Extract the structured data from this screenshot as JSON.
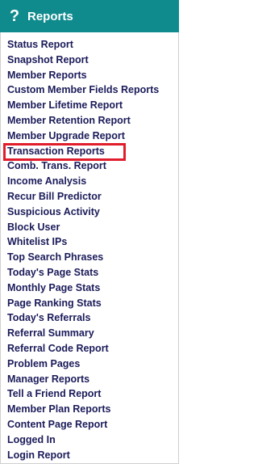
{
  "header": {
    "title": "Reports",
    "icon": "?",
    "background": "#0f8a8d"
  },
  "menu": {
    "items": [
      {
        "label": "Status Report"
      },
      {
        "label": "Snapshot Report"
      },
      {
        "label": "Member Reports"
      },
      {
        "label": "Custom Member Fields Reports"
      },
      {
        "label": "Member Lifetime Report"
      },
      {
        "label": "Member Retention Report"
      },
      {
        "label": "Member Upgrade Report"
      },
      {
        "label": "Transaction Reports",
        "highlighted": true
      },
      {
        "label": "Comb. Trans. Report"
      },
      {
        "label": "Income Analysis"
      },
      {
        "label": "Recur Bill Predictor"
      },
      {
        "label": "Suspicious Activity"
      },
      {
        "label": "Block User"
      },
      {
        "label": "Whitelist IPs"
      },
      {
        "label": "Top Search Phrases"
      },
      {
        "label": "Today's Page Stats"
      },
      {
        "label": "Monthly Page Stats"
      },
      {
        "label": "Page Ranking Stats"
      },
      {
        "label": "Today's Referrals"
      },
      {
        "label": "Referral Summary"
      },
      {
        "label": "Referral Code Report"
      },
      {
        "label": "Problem Pages"
      },
      {
        "label": "Manager Reports"
      },
      {
        "label": "Tell a Friend Report"
      },
      {
        "label": "Member Plan Reports"
      },
      {
        "label": "Content Page Report"
      },
      {
        "label": "Logged In"
      },
      {
        "label": "Login Report"
      }
    ]
  },
  "colors": {
    "link": "#1b1b5a",
    "highlight": "#e11d2b"
  }
}
